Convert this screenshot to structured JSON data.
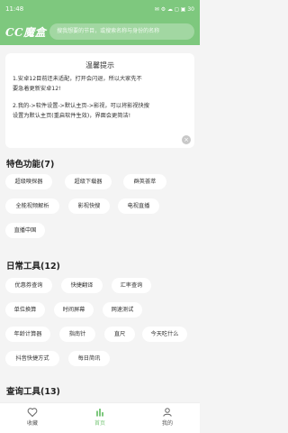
{
  "status_bar": {
    "time": "11:48",
    "icons": "✉ ⚙ ☁ ◻ ▣ 30"
  },
  "app_bar": {
    "logo": "CC魔盒",
    "search_placeholder": "搜我想要的节目，或搜索名称与身份的名称"
  },
  "notice": {
    "title": "温馨提示",
    "line1": "1.安卓12目前还未适配，打开会闪退，所以大家先不",
    "line2": "要急着更新安卓12!",
    "line3": "2.我的->软件设置->默认主页->影视，可以将影视快搜",
    "line4": "设置为默认主页(重启软件生效)，界面会更简洁!",
    "close": "×"
  },
  "sections": {
    "features": {
      "title": "特色功能(7)",
      "items": [
        "超级嗅探器",
        "超级下载器",
        "群英荟萃",
        "全能视频解析",
        "影视快搜",
        "电视直播",
        "直播中国"
      ]
    },
    "daily": {
      "title": "日常工具(12)",
      "items": [
        "优惠券查询",
        "快捷翻译",
        "汇率查询",
        "单位换算",
        "时间屏幕",
        "网速测试",
        "年龄计算器",
        "指南针",
        "直尺",
        "今天吃什么",
        "抖音快捷方式",
        "每日简讯"
      ]
    },
    "query": {
      "title": "查询工具(13)"
    }
  },
  "bottom_nav": {
    "items": [
      {
        "label": "收藏",
        "icon": "heart-icon"
      },
      {
        "label": "首页",
        "icon": "home-icon"
      },
      {
        "label": "我的",
        "icon": "person-icon"
      }
    ],
    "active_index": 1
  },
  "colors": {
    "accent": "#7ec87e",
    "background": "#f4f4f4",
    "card": "#ffffff"
  }
}
